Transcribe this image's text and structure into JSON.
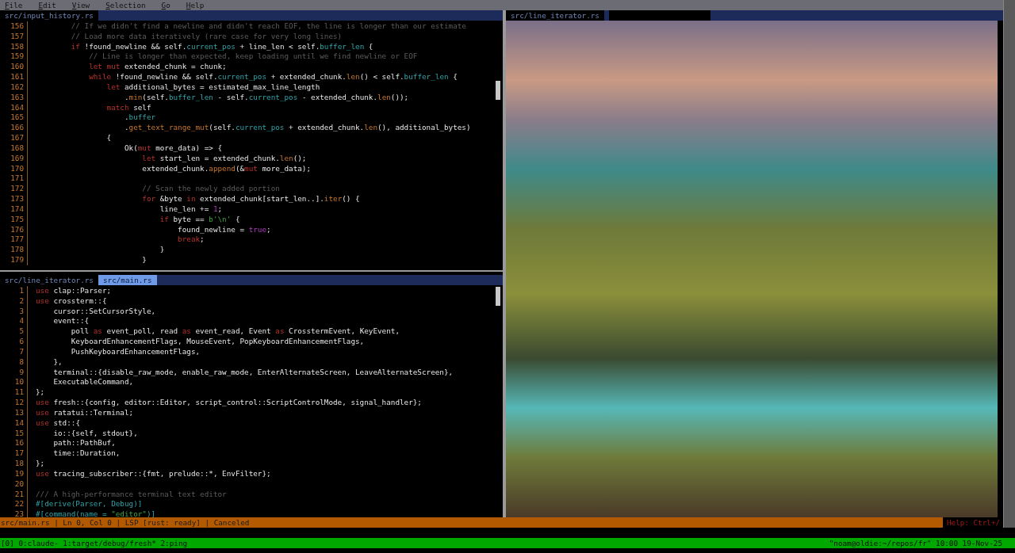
{
  "menu": [
    "File",
    "Edit",
    "View",
    "Selection",
    "Go",
    "Help"
  ],
  "top_pane": {
    "tabs": [
      {
        "label": "src/input_history.rs",
        "selected": false
      }
    ],
    "lines": [
      {
        "n": "156",
        "segs": [
          {
            "kind": "comment",
            "text": "        // If we didn't find a newline and didn't reach EOF, the line is longer than our estimate"
          }
        ]
      },
      {
        "n": "157",
        "segs": [
          {
            "kind": "comment",
            "text": "        // Load more data iteratively (rare case for very long lines)"
          }
        ]
      },
      {
        "n": "158",
        "segs": [
          {
            "kind": "keyword",
            "text": "        if"
          },
          {
            "kind": "plain",
            "text": " !found_newline && self."
          },
          {
            "kind": "field",
            "text": "current_pos"
          },
          {
            "kind": "plain",
            "text": " + line_len < self."
          },
          {
            "kind": "field",
            "text": "buffer_len"
          },
          {
            "kind": "plain",
            "text": " {"
          }
        ]
      },
      {
        "n": "159",
        "segs": [
          {
            "kind": "comment",
            "text": "            // Line is longer than expected, keep loading until we find newline or EOF"
          }
        ]
      },
      {
        "n": "160",
        "segs": [
          {
            "kind": "keyword",
            "text": "            let mut"
          },
          {
            "kind": "plain",
            "text": " extended_chunk = chunk;"
          }
        ]
      },
      {
        "n": "161",
        "segs": [
          {
            "kind": "keyword",
            "text": "            while"
          },
          {
            "kind": "plain",
            "text": " !found_newline && self."
          },
          {
            "kind": "field",
            "text": "current_pos"
          },
          {
            "kind": "plain",
            "text": " + extended_chunk."
          },
          {
            "kind": "method",
            "text": "len"
          },
          {
            "kind": "plain",
            "text": "() < self."
          },
          {
            "kind": "field",
            "text": "buffer_len"
          },
          {
            "kind": "plain",
            "text": " {"
          }
        ]
      },
      {
        "n": "162",
        "segs": [
          {
            "kind": "keyword",
            "text": "                let"
          },
          {
            "kind": "plain",
            "text": " additional_bytes = estimated_max_line_length"
          }
        ]
      },
      {
        "n": "163",
        "segs": [
          {
            "kind": "plain",
            "text": "                    ."
          },
          {
            "kind": "method",
            "text": "min"
          },
          {
            "kind": "plain",
            "text": "(self."
          },
          {
            "kind": "field",
            "text": "buffer_len"
          },
          {
            "kind": "plain",
            "text": " - self."
          },
          {
            "kind": "field",
            "text": "current_pos"
          },
          {
            "kind": "plain",
            "text": " - extended_chunk."
          },
          {
            "kind": "method",
            "text": "len"
          },
          {
            "kind": "plain",
            "text": "());"
          }
        ]
      },
      {
        "n": "164",
        "segs": [
          {
            "kind": "keyword",
            "text": "                match"
          },
          {
            "kind": "plain",
            "text": " self"
          }
        ]
      },
      {
        "n": "165",
        "segs": [
          {
            "kind": "plain",
            "text": "                    ."
          },
          {
            "kind": "field",
            "text": "buffer"
          }
        ]
      },
      {
        "n": "166",
        "segs": [
          {
            "kind": "plain",
            "text": "                    ."
          },
          {
            "kind": "method",
            "text": "get_text_range_mut"
          },
          {
            "kind": "plain",
            "text": "(self."
          },
          {
            "kind": "field",
            "text": "current_pos"
          },
          {
            "kind": "plain",
            "text": " + extended_chunk."
          },
          {
            "kind": "method",
            "text": "len"
          },
          {
            "kind": "plain",
            "text": "(), additional_bytes)"
          }
        ]
      },
      {
        "n": "167",
        "segs": [
          {
            "kind": "plain",
            "text": "                {"
          }
        ]
      },
      {
        "n": "168",
        "segs": [
          {
            "kind": "plain",
            "text": "                    Ok("
          },
          {
            "kind": "keyword",
            "text": "mut"
          },
          {
            "kind": "plain",
            "text": " more_data) => {"
          }
        ]
      },
      {
        "n": "169",
        "segs": [
          {
            "kind": "keyword",
            "text": "                        let"
          },
          {
            "kind": "plain",
            "text": " start_len = extended_chunk."
          },
          {
            "kind": "method",
            "text": "len"
          },
          {
            "kind": "plain",
            "text": "();"
          }
        ]
      },
      {
        "n": "170",
        "segs": [
          {
            "kind": "plain",
            "text": "                        extended_chunk."
          },
          {
            "kind": "method",
            "text": "append"
          },
          {
            "kind": "plain",
            "text": "(&"
          },
          {
            "kind": "keyword",
            "text": "mut"
          },
          {
            "kind": "plain",
            "text": " more_data);"
          }
        ]
      },
      {
        "n": "171"
      },
      {
        "n": "172",
        "segs": [
          {
            "kind": "comment",
            "text": "                        // Scan the newly added portion"
          }
        ]
      },
      {
        "n": "173",
        "segs": [
          {
            "kind": "keyword",
            "text": "                        for"
          },
          {
            "kind": "plain",
            "text": " &byte "
          },
          {
            "kind": "keyword",
            "text": "in"
          },
          {
            "kind": "plain",
            "text": " extended_chunk[start_len..]."
          },
          {
            "kind": "method",
            "text": "iter"
          },
          {
            "kind": "plain",
            "text": "() {"
          }
        ]
      },
      {
        "n": "174",
        "segs": [
          {
            "kind": "plain",
            "text": "                            line_len += "
          },
          {
            "kind": "number",
            "text": "1"
          },
          {
            "kind": "plain",
            "text": ";"
          }
        ]
      },
      {
        "n": "175",
        "segs": [
          {
            "kind": "keyword",
            "text": "                            if"
          },
          {
            "kind": "plain",
            "text": " byte == "
          },
          {
            "kind": "string",
            "text": "b'\\n'"
          },
          {
            "kind": "plain",
            "text": " {"
          }
        ]
      },
      {
        "n": "176",
        "segs": [
          {
            "kind": "plain",
            "text": "                                found_newline = "
          },
          {
            "kind": "number",
            "text": "true"
          },
          {
            "kind": "plain",
            "text": ";"
          }
        ]
      },
      {
        "n": "177",
        "segs": [
          {
            "kind": "keyword",
            "text": "                                break"
          },
          {
            "kind": "plain",
            "text": ";"
          }
        ]
      },
      {
        "n": "178",
        "segs": [
          {
            "kind": "plain",
            "text": "                            }"
          }
        ]
      },
      {
        "n": "179",
        "segs": [
          {
            "kind": "plain",
            "text": "                        }"
          }
        ]
      }
    ]
  },
  "bottom_pane": {
    "tabs": [
      {
        "label": "src/line_iterator.rs",
        "selected": false
      },
      {
        "label": "src/main.rs",
        "selected": true
      }
    ],
    "lines": [
      {
        "n": "1",
        "segs": [
          {
            "kind": "keyword",
            "text": "use"
          },
          {
            "kind": "plain",
            "text": " clap::Parser;"
          }
        ]
      },
      {
        "n": "2",
        "segs": [
          {
            "kind": "keyword",
            "text": "use"
          },
          {
            "kind": "plain",
            "text": " crossterm::{"
          }
        ]
      },
      {
        "n": "3",
        "segs": [
          {
            "kind": "plain",
            "text": "    cursor::SetCursorStyle,"
          }
        ]
      },
      {
        "n": "4",
        "segs": [
          {
            "kind": "plain",
            "text": "    event::{"
          }
        ]
      },
      {
        "n": "5",
        "segs": [
          {
            "kind": "plain",
            "text": "        poll "
          },
          {
            "kind": "keyword",
            "text": "as"
          },
          {
            "kind": "plain",
            "text": " event_poll, read "
          },
          {
            "kind": "keyword",
            "text": "as"
          },
          {
            "kind": "plain",
            "text": " event_read, Event "
          },
          {
            "kind": "keyword",
            "text": "as"
          },
          {
            "kind": "plain",
            "text": " CrosstermEvent, KeyEvent,"
          }
        ]
      },
      {
        "n": "6",
        "segs": [
          {
            "kind": "plain",
            "text": "        KeyboardEnhancementFlags, MouseEvent, PopKeyboardEnhancementFlags,"
          }
        ]
      },
      {
        "n": "7",
        "segs": [
          {
            "kind": "plain",
            "text": "        PushKeyboardEnhancementFlags,"
          }
        ]
      },
      {
        "n": "8",
        "segs": [
          {
            "kind": "plain",
            "text": "    },"
          }
        ]
      },
      {
        "n": "9",
        "segs": [
          {
            "kind": "plain",
            "text": "    terminal::{disable_raw_mode, enable_raw_mode, EnterAlternateScreen, LeaveAlternateScreen},"
          }
        ]
      },
      {
        "n": "10",
        "segs": [
          {
            "kind": "plain",
            "text": "    ExecutableCommand,"
          }
        ]
      },
      {
        "n": "11",
        "segs": [
          {
            "kind": "plain",
            "text": "};"
          }
        ]
      },
      {
        "n": "12",
        "segs": [
          {
            "kind": "keyword",
            "text": "use"
          },
          {
            "kind": "plain",
            "text": " fresh::{config, editor::Editor, script_control::ScriptControlMode, signal_handler};"
          }
        ]
      },
      {
        "n": "13",
        "segs": [
          {
            "kind": "keyword",
            "text": "use"
          },
          {
            "kind": "plain",
            "text": " ratatui::Terminal;"
          }
        ]
      },
      {
        "n": "14",
        "segs": [
          {
            "kind": "keyword",
            "text": "use"
          },
          {
            "kind": "plain",
            "text": " std::{"
          }
        ]
      },
      {
        "n": "15",
        "segs": [
          {
            "kind": "plain",
            "text": "    io::{self, stdout},"
          }
        ]
      },
      {
        "n": "16",
        "segs": [
          {
            "kind": "plain",
            "text": "    path::PathBuf,"
          }
        ]
      },
      {
        "n": "17",
        "segs": [
          {
            "kind": "plain",
            "text": "    time::Duration,"
          }
        ]
      },
      {
        "n": "18",
        "segs": [
          {
            "kind": "plain",
            "text": "};"
          }
        ]
      },
      {
        "n": "19",
        "segs": [
          {
            "kind": "keyword",
            "text": "use"
          },
          {
            "kind": "plain",
            "text": " tracing_subscriber::{fmt, prelude::*, EnvFilter};"
          }
        ]
      },
      {
        "n": "20"
      },
      {
        "n": "21",
        "segs": [
          {
            "kind": "comment",
            "text": "/// A high-performance terminal text editor"
          }
        ]
      },
      {
        "n": "22",
        "segs": [
          {
            "kind": "attribute",
            "text": "#[derive(Parser, Debug)]"
          }
        ]
      },
      {
        "n": "23",
        "segs": [
          {
            "kind": "attribute",
            "text": "#[command(name = "
          },
          {
            "kind": "string",
            "text": "\"editor\""
          },
          {
            "kind": "attribute",
            "text": ")]"
          }
        ]
      }
    ]
  },
  "right_pane": {
    "tabs": [
      {
        "label": "src/line_iterator.rs",
        "selected": false
      }
    ]
  },
  "status_bar": {
    "text": "src/main.rs | Ln 0, Col 0 | LSP [rust: ready] | Canceled",
    "help": "Help: Ctrl+/"
  },
  "tmux_bar": {
    "left": "[0] 0:claude- 1:target/debug/fresh* 2:ping",
    "right": "\"noam@oldie:~/repos/fr\" 10:00 19-Nov-25"
  }
}
